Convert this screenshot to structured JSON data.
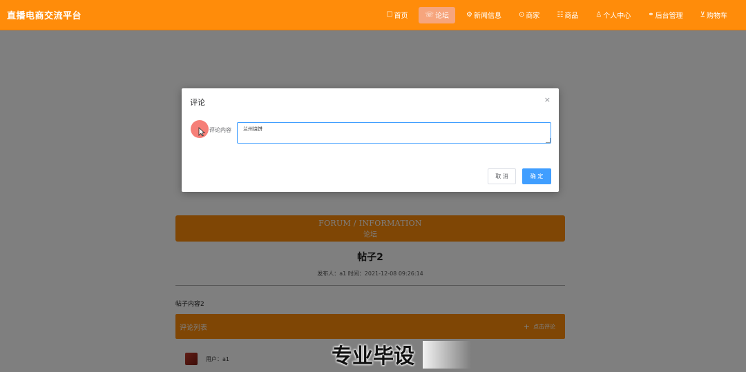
{
  "navbar": {
    "brand": "直播电商交流平台",
    "items": [
      {
        "icon": "home-icon",
        "glyph": "☐",
        "label": "首页",
        "active": false
      },
      {
        "icon": "forum-icon",
        "glyph": "☏",
        "label": "论坛",
        "active": true
      },
      {
        "icon": "news-icon",
        "glyph": "⚙",
        "label": "新闻信息",
        "active": false
      },
      {
        "icon": "product-icon",
        "glyph": "⊙",
        "label": "商家",
        "active": false
      },
      {
        "icon": "goods-icon",
        "glyph": "☷",
        "label": "商品",
        "active": false
      },
      {
        "icon": "user-icon",
        "glyph": "♙",
        "label": "个人中心",
        "active": false
      },
      {
        "icon": "link-icon",
        "glyph": "⚭",
        "label": "后台管理",
        "active": false
      },
      {
        "icon": "cart-icon",
        "glyph": "⊻",
        "label": "购物车",
        "active": false
      }
    ]
  },
  "page": {
    "banner_en": "FORUM / INFORMATION",
    "banner_cn": "论坛",
    "post_title": "帖子2",
    "post_meta": "发布人：a1  时间：2021-12-08 09:26:14",
    "post_content": "帖子内容2",
    "comment_list_label": "评论列表",
    "add_comment_label": "点击评论",
    "comment_user": "用户：a1"
  },
  "dialog": {
    "title": "评论",
    "close_glyph": "×",
    "field_label": "评论内容",
    "field_value": "兰州烧饼",
    "cancel_label": "取 消",
    "confirm_label": "确 定"
  },
  "caption": "专业毕设",
  "colors": {
    "accent": "#ff8c0a",
    "primary_button": "#409eff",
    "overlay": "rgba(0,0,0,0.5)"
  }
}
